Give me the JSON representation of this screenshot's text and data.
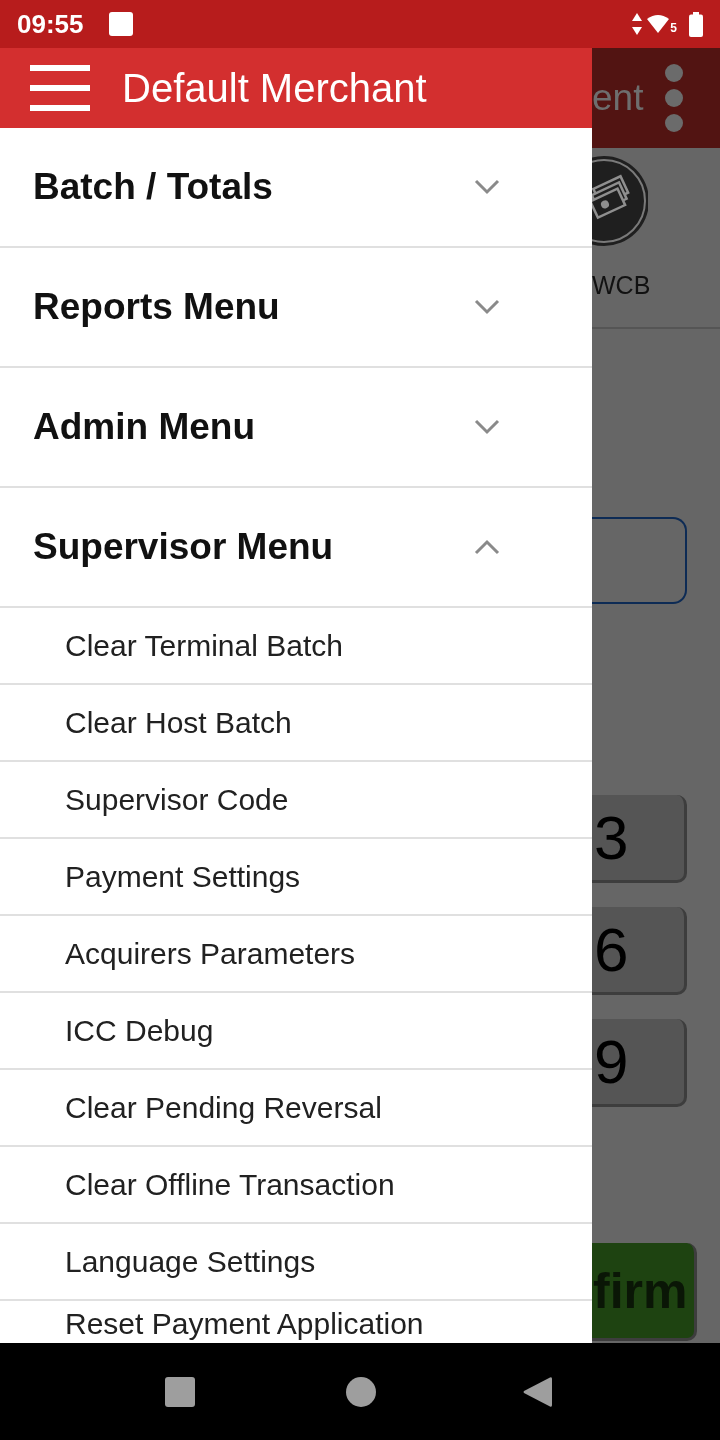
{
  "status_bar": {
    "time": "09:55",
    "network_badge": "5"
  },
  "drawer": {
    "title": "Default Merchant",
    "menu": [
      {
        "label": "Batch / Totals",
        "expanded": false
      },
      {
        "label": "Reports Menu",
        "expanded": false
      },
      {
        "label": "Admin Menu",
        "expanded": false
      },
      {
        "label": "Supervisor Menu",
        "expanded": true,
        "children": [
          {
            "label": "Clear Terminal Batch"
          },
          {
            "label": "Clear Host Batch"
          },
          {
            "label": "Supervisor Code"
          },
          {
            "label": "Payment Settings"
          },
          {
            "label": "Acquirers Parameters"
          },
          {
            "label": "ICC Debug"
          },
          {
            "label": "Clear Pending Reversal"
          },
          {
            "label": "Clear Offline Transaction"
          },
          {
            "label": "Language Settings"
          },
          {
            "label": "Reset Payment Application"
          }
        ]
      }
    ]
  },
  "background_app": {
    "title": "ent",
    "tile_label": "WCB",
    "keys": [
      "3",
      "6",
      "9"
    ],
    "action_button": "firm"
  }
}
